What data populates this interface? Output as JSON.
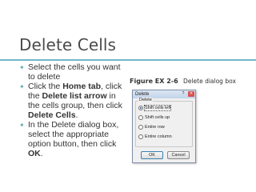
{
  "slide": {
    "title": "Delete Cells",
    "bullets": [
      {
        "segments": [
          {
            "text": "Select the cells you want to delete",
            "bold": false
          }
        ]
      },
      {
        "segments": [
          {
            "text": "Click the ",
            "bold": false
          },
          {
            "text": "Home tab",
            "bold": true
          },
          {
            "text": ", click the ",
            "bold": false
          },
          {
            "text": "Delete list arrow",
            "bold": true
          },
          {
            "text": " in the cells group, then click ",
            "bold": false
          },
          {
            "text": "Delete Cells",
            "bold": true
          },
          {
            "text": ".",
            "bold": false
          }
        ]
      },
      {
        "segments": [
          {
            "text": "In the Delete dialog box, select the appropriate option button, then click ",
            "bold": false
          },
          {
            "text": "OK",
            "bold": true
          },
          {
            "text": ".",
            "bold": false
          }
        ]
      }
    ]
  },
  "figure": {
    "number": "Figure EX 2-6",
    "caption": "Delete dialog box"
  },
  "dialog": {
    "title": "Delete",
    "help_glyph": "?",
    "close_glyph": "✕",
    "group_label": "Delete",
    "options": [
      {
        "label": "Shift cells left",
        "selected": true
      },
      {
        "label": "Shift cells up",
        "selected": false
      },
      {
        "label": "Entire row",
        "selected": false
      },
      {
        "label": "Entire column",
        "selected": false
      }
    ],
    "ok_label": "OK",
    "cancel_label": "Cancel"
  },
  "colors": {
    "accent": "#6fb7c7",
    "title_text": "#4a4a4a"
  }
}
